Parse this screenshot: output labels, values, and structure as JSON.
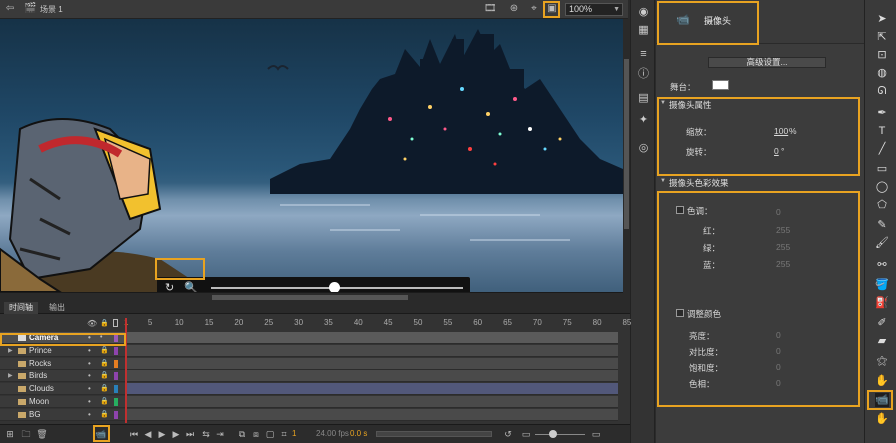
{
  "topbar": {
    "scene_label": "场景 1",
    "zoom_value": "100%"
  },
  "timeline": {
    "tabs": [
      "时间轴",
      "输出"
    ],
    "ruler_ticks": [
      "1",
      "5",
      "10",
      "15",
      "20",
      "25",
      "30",
      "35",
      "40",
      "45",
      "50",
      "55",
      "60",
      "65",
      "70",
      "75",
      "80",
      "85"
    ],
    "layers": [
      {
        "name": "Camera",
        "color": "#9b59b6",
        "selected": true
      },
      {
        "name": "Prince",
        "color": "#8e44ad",
        "folder": true
      },
      {
        "name": "Rocks",
        "color": "#e67e22"
      },
      {
        "name": "Birds",
        "color": "#8e44ad",
        "folder": true
      },
      {
        "name": "Clouds",
        "color": "#2980b9"
      },
      {
        "name": "Moon",
        "color": "#27ae60"
      },
      {
        "name": "BG",
        "color": "#8e44ad"
      }
    ],
    "current_frame": "1",
    "fps": "24.00 fps",
    "time": "0.0 s"
  },
  "properties": {
    "object_title": "摄像头",
    "advanced_button": "高级设置...",
    "stage_label": "舞台：",
    "section_camera_props": "摄像头属性",
    "zoom_label": "缩放：",
    "zoom_value": "100",
    "zoom_unit": "%",
    "rotate_label": "旋转：",
    "rotate_value": "0",
    "rotate_unit": "°",
    "section_color_effect": "摄像头色彩效果",
    "tint_label": "色调：",
    "tint_value": "0",
    "red_label": "红：",
    "red_value": "255",
    "green_label": "绿：",
    "green_value": "255",
    "blue_label": "蓝：",
    "blue_value": "255",
    "adjust_color_label": "调整颜色",
    "brightness_label": "亮度：",
    "brightness_value": "0",
    "contrast_label": "对比度：",
    "contrast_value": "0",
    "saturation_label": "饱和度：",
    "saturation_value": "0",
    "hue_label": "色相：",
    "hue_value": "0"
  },
  "colors": {
    "highlight": "#e8a321",
    "playhead": "#c03030"
  }
}
